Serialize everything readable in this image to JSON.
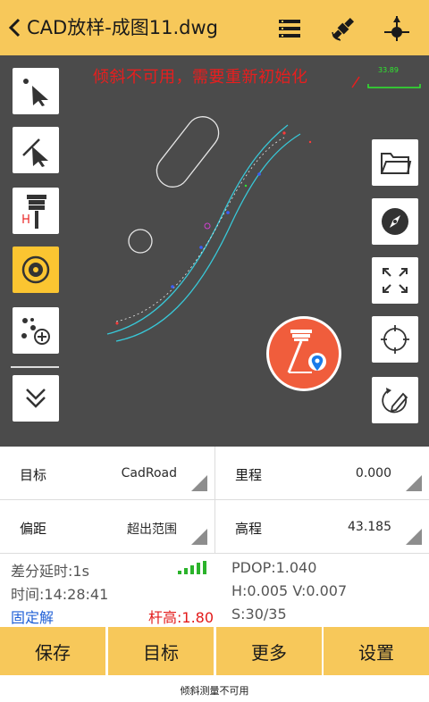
{
  "header": {
    "title": "CAD放样-成图11.dwg",
    "icons": [
      "back-icon",
      "menu-list-icon",
      "satellite-icon",
      "gps-fix-icon"
    ]
  },
  "map": {
    "warning": "倾斜不可用，需要重新初始化",
    "scale_label": "33.89",
    "scale_color": "#2eea2e",
    "warning_color": "#e81e1e",
    "left_tools": [
      "select-arrow-icon",
      "select-line-icon",
      "rover-pole-icon",
      "target-point-icon",
      "add-points-icon",
      "expand-down-icon"
    ],
    "right_tools": [
      "folder-icon",
      "compass-icon",
      "fullscreen-icon",
      "locate-icon",
      "edit-icon"
    ],
    "main_action": "stake-out-icon"
  },
  "info": {
    "target_label": "目标",
    "target_value": "CadRoad",
    "mileage_label": "里程",
    "mileage_value": "0.000",
    "offset_label": "偏距",
    "offset_value": "超出范围",
    "elevation_label": "高程",
    "elevation_value": "43.185"
  },
  "status": {
    "diff_delay": "差分延时:1s",
    "pdop": "PDOP:1.040",
    "time": "时间:14:28:41",
    "hv": "H:0.005  V:0.007",
    "solution": "固定解",
    "pole_height": "杆高:1.80",
    "satellites": "S:30/35",
    "signal_color": "#2bb32b"
  },
  "buttons": {
    "save": "保存",
    "target": "目标",
    "more": "更多",
    "settings": "设置"
  },
  "toast": "倾斜测量不可用",
  "colors": {
    "accent": "#f7c85a",
    "map_bg": "#4b4b4b",
    "active_tool": "#fbc531",
    "stake_button": "#f05d3c",
    "fixed_solution": "#1f5fd6",
    "pole_height": "#e31b1b"
  }
}
